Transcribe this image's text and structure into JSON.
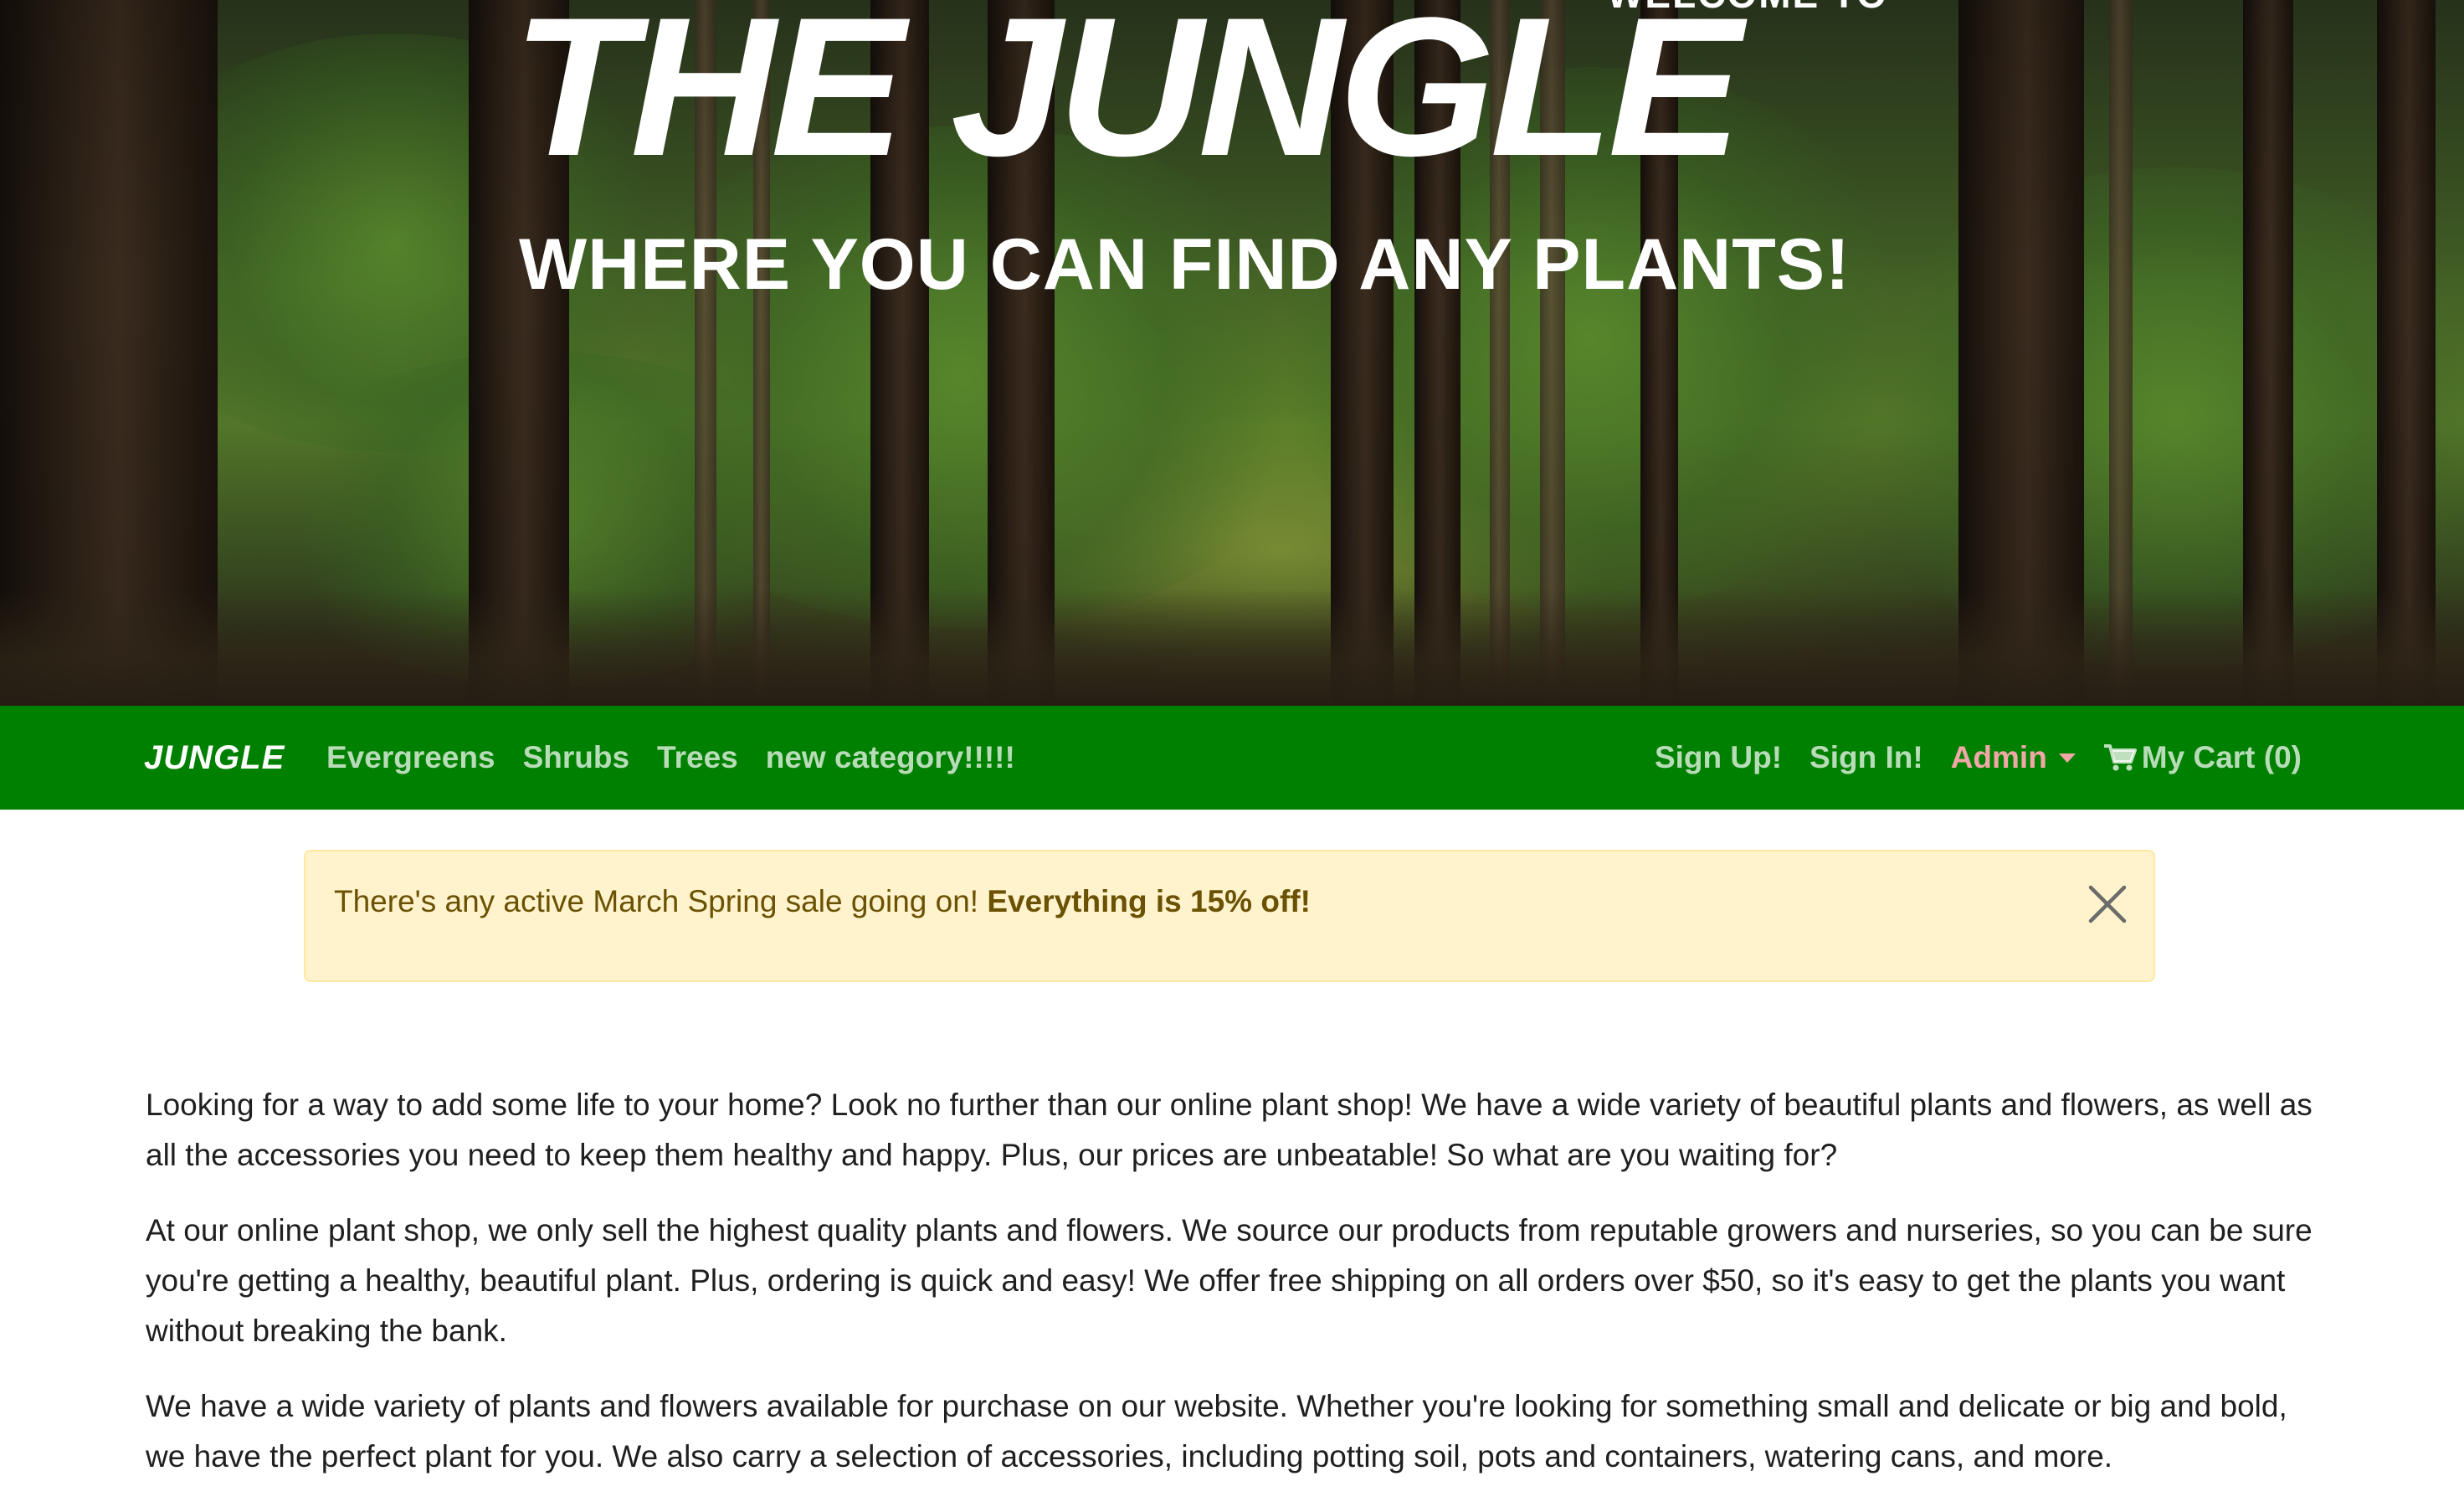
{
  "hero": {
    "welcome": "WELCOME TO",
    "title": "THE JUNGLE",
    "subtitle": "WHERE YOU CAN FIND ANY PLANTS!"
  },
  "navbar": {
    "brand": "JUNGLE",
    "categories": [
      "Evergreens",
      "Shrubs",
      "Trees",
      "new category!!!!!"
    ],
    "sign_up": "Sign Up!",
    "sign_in": "Sign In!",
    "admin": "Admin",
    "cart": "My Cart (0)"
  },
  "alert": {
    "text": "There's any active March Spring sale going on! ",
    "emphasis": "Everything is 15% off!"
  },
  "content": {
    "paragraphs": [
      "Looking for a way to add some life to your home? Look no further than our online plant shop! We have a wide variety of beautiful plants and flowers, as well as all the accessories you need to keep them healthy and happy. Plus, our prices are unbeatable! So what are you waiting for?",
      "At our online plant shop, we only sell the highest quality plants and flowers. We source our products from reputable growers and nurseries, so you can be sure you're getting a healthy, beautiful plant. Plus, ordering is quick and easy! We offer free shipping on all orders over $50, so it's easy to get the plants you want without breaking the bank.",
      "We have a wide variety of plants and flowers available for purchase on our website. Whether you're looking for something small and delicate or big and bold, we have the perfect plant for you. We also carry a selection of accessories, including potting soil, pots and containers, watering cans, and more."
    ]
  },
  "colors": {
    "navbar_bg": "#008000",
    "alert_bg": "#fff3cd",
    "admin_link": "#f2a7a7"
  },
  "icons": {
    "cart": "shopping-cart-icon",
    "close": "close-icon",
    "admin_caret": "caret-down-icon"
  }
}
